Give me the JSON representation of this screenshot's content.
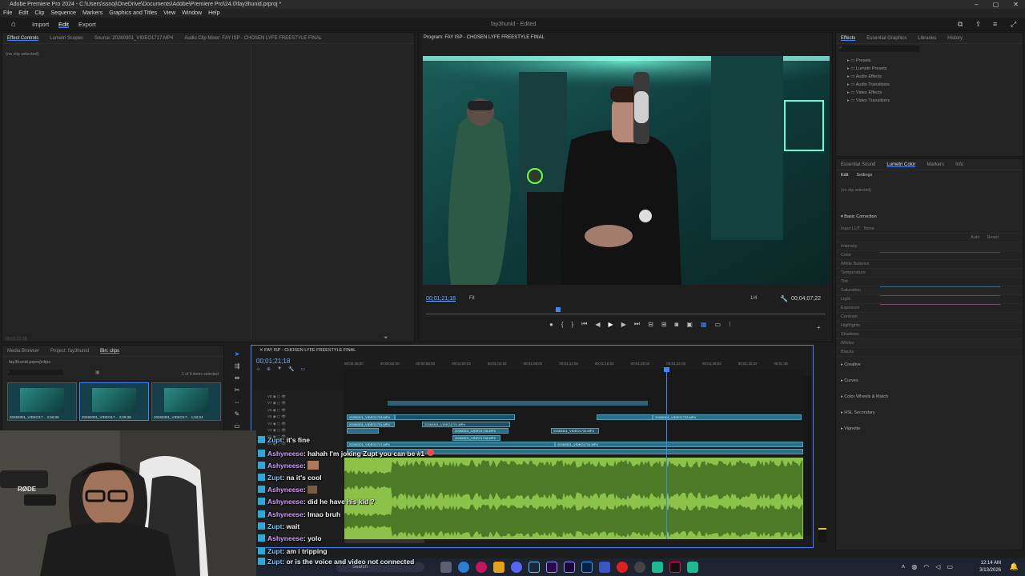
{
  "app": {
    "title": "Adobe Premiere Pro 2024 - C:\\Users\\ssnoj\\OneDrive\\Documents\\Adobe\\Premiere Pro\\24.0\\fay3hunid.prproj *",
    "menu": [
      "File",
      "Edit",
      "Clip",
      "Sequence",
      "Markers",
      "Graphics and Titles",
      "View",
      "Window",
      "Help"
    ],
    "workspace_tabs": [
      "Import",
      "Edit",
      "Export"
    ],
    "project_status": "fay3hunid  -  Edited",
    "window_buttons": [
      "–",
      "▢",
      "✕"
    ]
  },
  "source_panel": {
    "tabs": [
      "Effect Controls",
      "Lumetri Scopes",
      "Source: 20260301_VIDEO1717.MP4",
      "Audio Clip Mixer: FAY ISP - CHOSEN LYFE FREESTYLE FINAL"
    ],
    "empty_msg": "(no clip selected)",
    "timecode": "00;01;21;18"
  },
  "program": {
    "title": "Program: FAY ISP - CHOSEN LYFE FREESTYLE FINAL",
    "timecode": "00;01;21;18",
    "fit": "Fit",
    "resolution": "1/4",
    "duration": "00;04;07;22",
    "playhead_fraction": 0.33
  },
  "effects": {
    "tabs": [
      "Effects",
      "Essential Graphics",
      "Libraries",
      "History"
    ],
    "folders": [
      "Presets",
      "Lumetri Presets",
      "Audio Effects",
      "Audio Transitions",
      "Video Effects",
      "Video Transitions"
    ]
  },
  "lumetri": {
    "tabs": [
      "Essential Sound",
      "Lumetri Color",
      "Markers",
      "Info"
    ],
    "subtabs": [
      "Edit",
      "Settings"
    ],
    "empty_msg": "(no clip selected)",
    "basic": "Basic Correction",
    "input_lut": "Input LUT",
    "lut_value": "None",
    "auto": "Auto",
    "reset": "Reset",
    "intensity": "Intensity",
    "color": "Color",
    "wb": "White Balance",
    "temp": "Temperature",
    "tint": "Tint",
    "sat": "Saturation",
    "light": "Light",
    "exposure": "Exposure",
    "contrast": "Contrast",
    "highlights": "Highlights",
    "shadows": "Shadows",
    "whites": "Whites",
    "blacks": "Blacks",
    "sections": [
      "Creative",
      "Curves",
      "Color Wheels & Match",
      "HSL Secondary",
      "Vignette"
    ]
  },
  "project": {
    "tabs": [
      "Media Browser",
      "Project: fay3hunid",
      "Bin: clips"
    ],
    "path": "fay3hunid.prproj\\clips",
    "selected": "1 of 9 items selected",
    "clips": [
      {
        "name": "20260301_VIDEO17...",
        "dur": "2;56;06"
      },
      {
        "name": "20260301_VIDEO17...",
        "dur": "2;09;38"
      },
      {
        "name": "20260301_VIDEO17...",
        "dur": "1;52;04"
      }
    ]
  },
  "timeline": {
    "title": "FAY ISP - CHOSEN LYFE FREESTYLE FINAL",
    "timecode": "00;01;21;18",
    "ruler": [
      "00;00;48;00",
      "00;00;52;00",
      "00;00;56;00",
      "00;01;00;02",
      "00;01;04;02",
      "00;01;08;02",
      "00;01;12;02",
      "00;01;16;02",
      "00;01;20;02",
      "00;01;24;02",
      "00;01;28;02",
      "00;01;32;02",
      "00;01;36"
    ],
    "clip_labels": [
      "20260301_VIDEO1723.MP4",
      "20260301_VIDEO1721.MP4",
      "20260301_VIDEO1716.MP4",
      "20260301_VIDEO1720.MP4",
      "20260301_VIDEO1718.MP4",
      "20260301_VIDEO1717.MP4",
      "20260301_VIDEO1714.MP4",
      "20260301_VIDEO1723.MP4",
      "20260301_VIDEO1719.MP4"
    ],
    "track_names": [
      "V8",
      "V7",
      "V6",
      "V5",
      "V4",
      "V3",
      "V2",
      "V1"
    ]
  },
  "chat": [
    {
      "user": "Zupt",
      "msg": ": it's fine",
      "color": "#6fc3ff"
    },
    {
      "user": "Ashyneese",
      "msg": ": hahah I'm joking Zupt you can be #1",
      "color": "#d39bff"
    },
    {
      "user": "Zupt",
      "msg": ": na it's cool",
      "color": "#6fc3ff"
    },
    {
      "user": "Ashyneese",
      "msg": ":",
      "color": "#d39bff"
    },
    {
      "user": "Ashyneese",
      "msg": ": did he have his kid ?",
      "color": "#d39bff"
    },
    {
      "user": "Ashyneese",
      "msg": ": lmao bruh",
      "color": "#d39bff"
    },
    {
      "user": "Zupt",
      "msg": ": wait",
      "color": "#6fc3ff"
    },
    {
      "user": "Ashyneese",
      "msg": ": yolo",
      "color": "#d39bff"
    },
    {
      "user": "Zupt",
      "msg": ": am i tripping",
      "color": "#6fc3ff"
    },
    {
      "user": "Zupt",
      "msg": ": or is the voice and video not connected",
      "color": "#6fc3ff"
    }
  ],
  "webcam": {
    "mic_brand": "RØDE"
  },
  "taskbar": {
    "search": "Search",
    "time": "12:14 AM",
    "date": "3/13/2026"
  },
  "colors": {
    "accent": "#3d85ff",
    "audio": "#8bc34a",
    "clip": "#2f6f86"
  }
}
